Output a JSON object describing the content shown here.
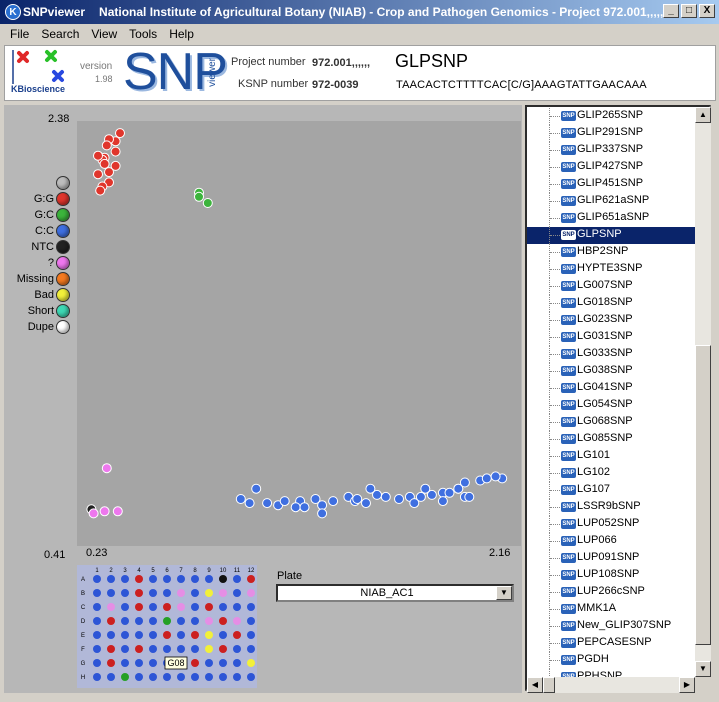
{
  "window": {
    "app_name": "SNPviewer",
    "title": "National Institute of Agricultural Botany (NIAB) - Crop and Pathogen Genomics - Project 972.001,,,,,,",
    "buttons": [
      "_",
      "□",
      "X"
    ]
  },
  "menu": [
    "File",
    "Search",
    "View",
    "Tools",
    "Help"
  ],
  "header": {
    "company": "KBioscience",
    "version_label": "version",
    "version_value": "1.98",
    "product_big": "SNP",
    "product_small": "viewer",
    "project_label": "Project number",
    "project_value": "972.001,,,,,,",
    "ksnp_label": "KSNP number",
    "ksnp_value": "972-0039",
    "snp_name": "GLPSNP",
    "sequence": "TAACACTCTTTTCAC[C/G]AAAGTATTGAACAAA"
  },
  "legend": [
    {
      "label": "",
      "color": "#bdbdbd"
    },
    {
      "label": "G:G",
      "color": "#e0362c"
    },
    {
      "label": "G:C",
      "color": "#3cb43c"
    },
    {
      "label": "C:C",
      "color": "#3f6fe0"
    },
    {
      "label": "NTC",
      "color": "#222222"
    },
    {
      "label": "?",
      "color": "#ee77ee"
    },
    {
      "label": "Missing",
      "color": "#f57a20"
    },
    {
      "label": "Bad",
      "color": "#f2f03a"
    },
    {
      "label": "Short",
      "color": "#3ed8b4"
    },
    {
      "label": "Dupe",
      "color": "#ffffff"
    }
  ],
  "chart_data": {
    "type": "scatter",
    "xlim": [
      0.23,
      2.16
    ],
    "ylim": [
      0.41,
      2.38
    ],
    "tick_labels": {
      "x_min": "0.23",
      "x_max": "2.16",
      "y_min": "0.41",
      "y_max": "2.38"
    },
    "series": [
      {
        "name": "G:G",
        "color": "#e0362c",
        "points": [
          [
            0.38,
            2.37
          ],
          [
            0.36,
            2.33
          ],
          [
            0.33,
            2.34
          ],
          [
            0.36,
            2.28
          ],
          [
            0.32,
            2.31
          ],
          [
            0.31,
            2.25
          ],
          [
            0.3,
            2.24
          ],
          [
            0.28,
            2.26
          ],
          [
            0.31,
            2.22
          ],
          [
            0.36,
            2.21
          ],
          [
            0.33,
            2.18
          ],
          [
            0.28,
            2.17
          ],
          [
            0.33,
            2.13
          ],
          [
            0.3,
            2.11
          ],
          [
            0.29,
            2.09
          ]
        ]
      },
      {
        "name": "G:C",
        "color": "#3cb43c",
        "points": [
          [
            0.74,
            2.08
          ],
          [
            0.74,
            2.06
          ],
          [
            0.78,
            2.03
          ]
        ]
      },
      {
        "name": "C:C",
        "color": "#3f6fe0",
        "points": [
          [
            1.0,
            0.64
          ],
          [
            0.93,
            0.59
          ],
          [
            0.97,
            0.57
          ],
          [
            1.05,
            0.57
          ],
          [
            1.1,
            0.56
          ],
          [
            1.13,
            0.58
          ],
          [
            1.2,
            0.58
          ],
          [
            1.27,
            0.59
          ],
          [
            1.18,
            0.55
          ],
          [
            1.22,
            0.55
          ],
          [
            1.3,
            0.56
          ],
          [
            1.35,
            0.58
          ],
          [
            1.42,
            0.6
          ],
          [
            1.3,
            0.52
          ],
          [
            1.45,
            0.58
          ],
          [
            1.5,
            0.57
          ],
          [
            1.46,
            0.59
          ],
          [
            1.52,
            0.64
          ],
          [
            1.55,
            0.61
          ],
          [
            1.59,
            0.6
          ],
          [
            1.65,
            0.59
          ],
          [
            1.7,
            0.6
          ],
          [
            1.75,
            0.6
          ],
          [
            1.77,
            0.64
          ],
          [
            1.8,
            0.61
          ],
          [
            1.85,
            0.62
          ],
          [
            1.88,
            0.62
          ],
          [
            1.92,
            0.64
          ],
          [
            1.95,
            0.67
          ],
          [
            2.02,
            0.68
          ],
          [
            2.05,
            0.69
          ],
          [
            2.12,
            0.69
          ],
          [
            2.09,
            0.7
          ],
          [
            1.72,
            0.57
          ],
          [
            1.85,
            0.58
          ],
          [
            1.92,
            0.64
          ],
          [
            1.95,
            0.6
          ],
          [
            1.97,
            0.6
          ]
        ]
      },
      {
        "name": "NTC",
        "color": "#222222",
        "points": [
          [
            0.25,
            0.54
          ]
        ]
      },
      {
        "name": "?",
        "color": "#ee77ee",
        "points": [
          [
            0.26,
            0.52
          ],
          [
            0.31,
            0.53
          ],
          [
            0.37,
            0.53
          ],
          [
            0.32,
            0.74
          ]
        ]
      }
    ]
  },
  "plate": {
    "label": "Plate",
    "selected": "NIAB_AC1",
    "col_labels": [
      "1",
      "2",
      "3",
      "4",
      "5",
      "6",
      "7",
      "8",
      "9",
      "10",
      "11",
      "12"
    ],
    "row_labels": [
      "A",
      "B",
      "C",
      "D",
      "E",
      "F",
      "G",
      "H"
    ],
    "tooltip": "G08",
    "wells": [
      "BBBRBBBBBKBR",
      "BBBRBBPBYPBP",
      "BPBRBRPBRBBB",
      "BRBBBGBBPRPB",
      "BBBBBRBRYBRB",
      "BRBRBBBBYRBB",
      "BRBBBBBRBBBY",
      "BBGBBBBBBBBB"
    ],
    "well_colors": {
      "B": "#2d55d6",
      "R": "#cc2020",
      "G": "#25a025",
      "P": "#e58ee5",
      "Y": "#f2f03a",
      "K": "#111111"
    }
  },
  "tree": {
    "items": [
      "GLIP265SNP",
      "GLIP291SNP",
      "GLIP337SNP",
      "GLIP427SNP",
      "GLIP451SNP",
      "GLIP621aSNP",
      "GLIP651aSNP",
      "GLPSNP",
      "HBP2SNP",
      "HYPTE3SNP",
      "LG007SNP",
      "LG018SNP",
      "LG023SNP",
      "LG031SNP",
      "LG033SNP",
      "LG038SNP",
      "LG041SNP",
      "LG054SNP",
      "LG068SNP",
      "LG085SNP",
      "LG101",
      "LG102",
      "LG107",
      "LSSR9bSNP",
      "LUP052SNP",
      "LUP066",
      "LUP091SNP",
      "LUP108SNP",
      "LUP266cSNP",
      "MMK1A",
      "New_GLIP307SNP",
      "PEPCASESNP",
      "PGDH",
      "PPHSNP"
    ],
    "selected": "GLPSNP",
    "icon_label": "SNP"
  }
}
